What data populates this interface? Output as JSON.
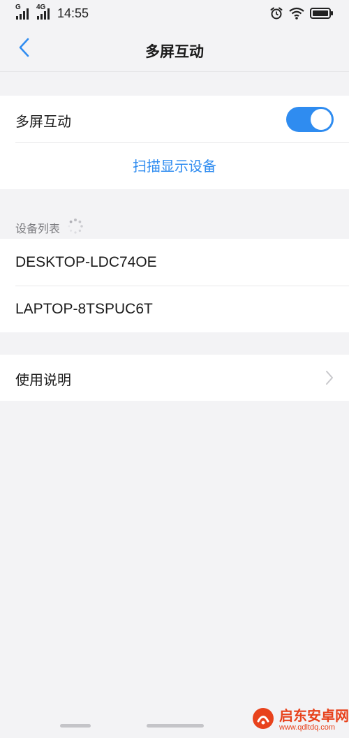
{
  "status_bar": {
    "signal_label": "G",
    "network_label": "4G",
    "time": "14:55",
    "icons": [
      "signal-icon",
      "signal-4g-icon",
      "alarm-icon",
      "wifi-icon",
      "battery-icon"
    ]
  },
  "header": {
    "title": "多屏互动",
    "back_icon": "chevron-left-icon"
  },
  "toggle_section": {
    "label": "多屏互动",
    "enabled": true,
    "scan_label": "扫描显示设备"
  },
  "devices_section": {
    "header": "设备列表",
    "loading_icon": "spinner-icon",
    "devices": [
      {
        "name": "DESKTOP-LDC74OE"
      },
      {
        "name": "LAPTOP-8TSPUC6T"
      }
    ]
  },
  "help_section": {
    "label": "使用说明",
    "icon": "chevron-right-icon"
  },
  "watermark": {
    "name": "启东安卓网",
    "url": "www.qdltdq.com"
  },
  "colors": {
    "accent": "#2f8cf0",
    "background": "#f3f3f5",
    "card": "#ffffff",
    "secondary_text": "#7a7a7e"
  }
}
